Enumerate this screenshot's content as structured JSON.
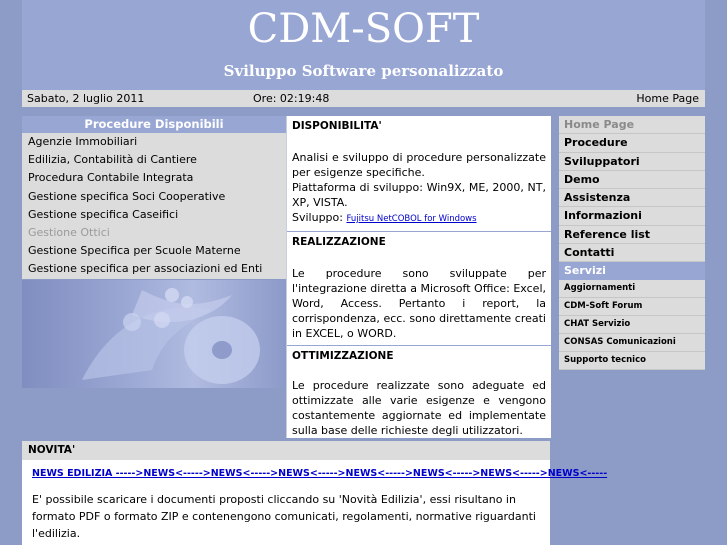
{
  "header": {
    "title": "CDM-SOFT",
    "subtitle": "Sviluppo Software personalizzato"
  },
  "infobar": {
    "date": "Sabato, 2 luglio 2011",
    "time": "Ore: 02:19:48",
    "home": "Home Page"
  },
  "left": {
    "heading": "Procedure Disponibili",
    "items": [
      "Agenzie Immobiliari",
      "Edilizia, Contabilità di Cantiere",
      "Procedura Contabile Integrata",
      "Gestione specifica Soci Cooperative",
      "Gestione specifica Caseifici",
      "Gestione Ottici",
      "Gestione Specifica per Scuole Materne",
      "Gestione specifica per associazioni ed Enti"
    ]
  },
  "middle": {
    "s1_title": "DISPONIBILITA'",
    "s1_text": "Analisi e sviluppo di procedure personalizzate per esigenze specifiche.",
    "s1_text2": "Piattaforma di sviluppo: Win9X, ME, 2000, NT, XP, VISTA.",
    "s1_prefix": "Sviluppo:",
    "s1_link": "Fujitsu NetCOBOL for Windows",
    "s2_title": "REALIZZAZIONE",
    "s2_text": "Le procedure sono sviluppate per l'integrazione diretta a Microsoft Office: Excel, Word, Access. Pertanto i report, la corrispondenza, ecc. sono direttamente creati in EXCEL, o WORD.",
    "s3_title": "OTTIMIZZAZIONE",
    "s3_text": "Le procedure realizzate sono adeguate ed ottimizzate alle varie esigenze e vengono costantemente aggiornate ed implementate sulla base delle richieste degli utilizzatori."
  },
  "right": {
    "nav": [
      "Home Page",
      "Procedure",
      "Sviluppatori",
      "Demo",
      "Assistenza",
      "Informazioni",
      "Reference list",
      "Contatti"
    ],
    "services_heading": "Servizi",
    "services": [
      "Aggiornamenti",
      "CDM-Soft Forum",
      "CHAT Servizio",
      "CONSAS Comunicazioni",
      "Supporto tecnico"
    ]
  },
  "news": {
    "heading": "NOVITA'",
    "link": "NEWS EDILIZIA ----->NEWS<----->NEWS<----->NEWS<----->NEWS<----->NEWS<----->NEWS<----->NEWS<-----",
    "text": "E' possibile scaricare i documenti proposti cliccando su 'Novità Edilizia', essi risultano in formato PDF o formato ZIP e contenengono comunicati, regolamenti, normative riguardanti l'edilizia."
  },
  "colors": {
    "band": "#98a6d3",
    "panel": "#dcdcdc",
    "link": "#0000cc"
  }
}
